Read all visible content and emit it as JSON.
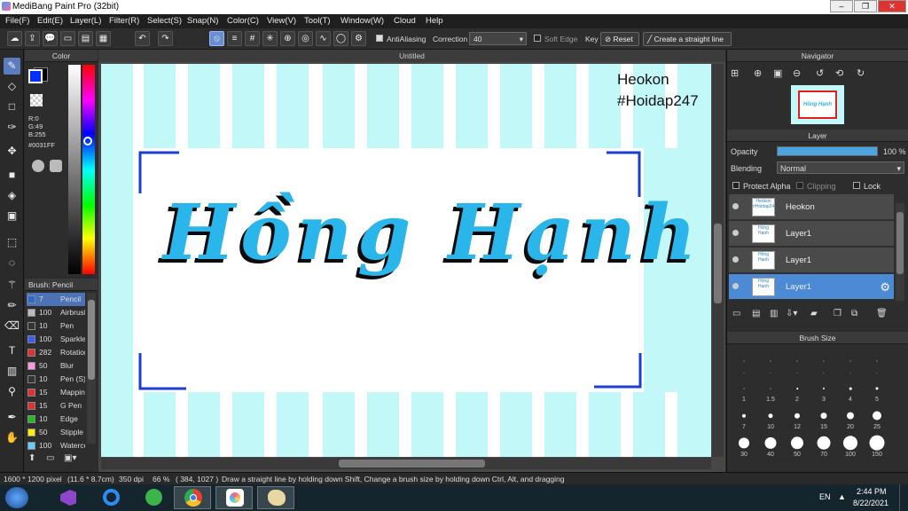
{
  "window": {
    "title": "MediBang Paint Pro (32bit)",
    "min": "–",
    "max": "❐",
    "close": "✕"
  },
  "menu": [
    "File(F)",
    "Edit(E)",
    "Layer(L)",
    "Filter(R)",
    "Select(S)",
    "Snap(N)",
    "Color(C)",
    "View(V)",
    "Tool(T)",
    "Window(W)",
    "Cloud",
    "Help"
  ],
  "toolbar": {
    "antialiasing": "AntiAliasing",
    "correction_label": "Correction",
    "correction_value": "40",
    "soft_edge": "Soft Edge",
    "key": "Key",
    "reset": "Reset",
    "straight_line": "Create a straight line"
  },
  "color_panel": {
    "title": "Color",
    "r": "R:0",
    "g": "G:49",
    "b": "B:255",
    "hex": "#0031FF",
    "fg_color": "#0031ff"
  },
  "brush_panel": {
    "title": "Brush: Pencil",
    "items": [
      {
        "size": "7",
        "name": "Pencil",
        "color": "#2a6ad0"
      },
      {
        "size": "100",
        "name": "Airbrush",
        "color": "#bbbbbb"
      },
      {
        "size": "10",
        "name": "Pen",
        "color": "#333333"
      },
      {
        "size": "100",
        "name": "Sparkle",
        "color": "#3b5bff"
      },
      {
        "size": "282",
        "name": "Rotation",
        "color": "#e03030"
      },
      {
        "size": "50",
        "name": "Blur",
        "color": "#ff99dd"
      },
      {
        "size": "10",
        "name": "Pen (S)",
        "color": "#333333"
      },
      {
        "size": "15",
        "name": "Mapping",
        "color": "#e03030"
      },
      {
        "size": "15",
        "name": "G Pen",
        "color": "#e03030"
      },
      {
        "size": "10",
        "name": "Edge",
        "color": "#22bb22"
      },
      {
        "size": "50",
        "name": "Stipple",
        "color": "#ffee00"
      },
      {
        "size": "100",
        "name": "Watercolor",
        "color": "#66ccff"
      }
    ]
  },
  "document": {
    "tab": "Untitled",
    "watermark_name": "Heokon",
    "watermark_tag": "#Hoidap247",
    "artwork_text": "Hồng Hạnh"
  },
  "navigator": {
    "title": "Navigator"
  },
  "layer_panel": {
    "title": "Layer",
    "opacity_label": "Opacity",
    "opacity_value": "100 %",
    "opacity_fraction": 1.0,
    "blending_label": "Blending",
    "blending_value": "Normal",
    "protect_alpha": "Protect Alpha",
    "clipping": "Clipping",
    "lock": "Lock",
    "layers": [
      {
        "name": "Heokon",
        "thumb": "Heokon #Hoidap247"
      },
      {
        "name": "Layer1",
        "thumb": "Hồng Hạnh"
      },
      {
        "name": "Layer1",
        "thumb": "Hồng Hạnh"
      },
      {
        "name": "Layer1",
        "thumb": "Hồng Hạnh"
      }
    ]
  },
  "brush_size": {
    "title": "Brush Size",
    "row1": [
      ".",
      ".",
      ".",
      ".",
      ".",
      "."
    ],
    "sizes": [
      "1",
      "1.5",
      "2",
      "3",
      "4",
      "5",
      "7",
      "10",
      "12",
      "15",
      "20",
      "25",
      "30",
      "40",
      "50",
      "70",
      "100",
      "150"
    ]
  },
  "status": {
    "pixels": "1600 * 1200 pixel",
    "cm": "(11.6 * 8.7cm)",
    "dpi": "350 dpi",
    "zoom": "66 %",
    "coords": "( 384, 1027 )",
    "hint": "Draw a straight line by holding down Shift, Change a brush size by holding down Ctrl, Alt, and dragging"
  },
  "taskbar": {
    "lang": "EN",
    "time": "2:44 PM",
    "date": "8/22/2021"
  }
}
